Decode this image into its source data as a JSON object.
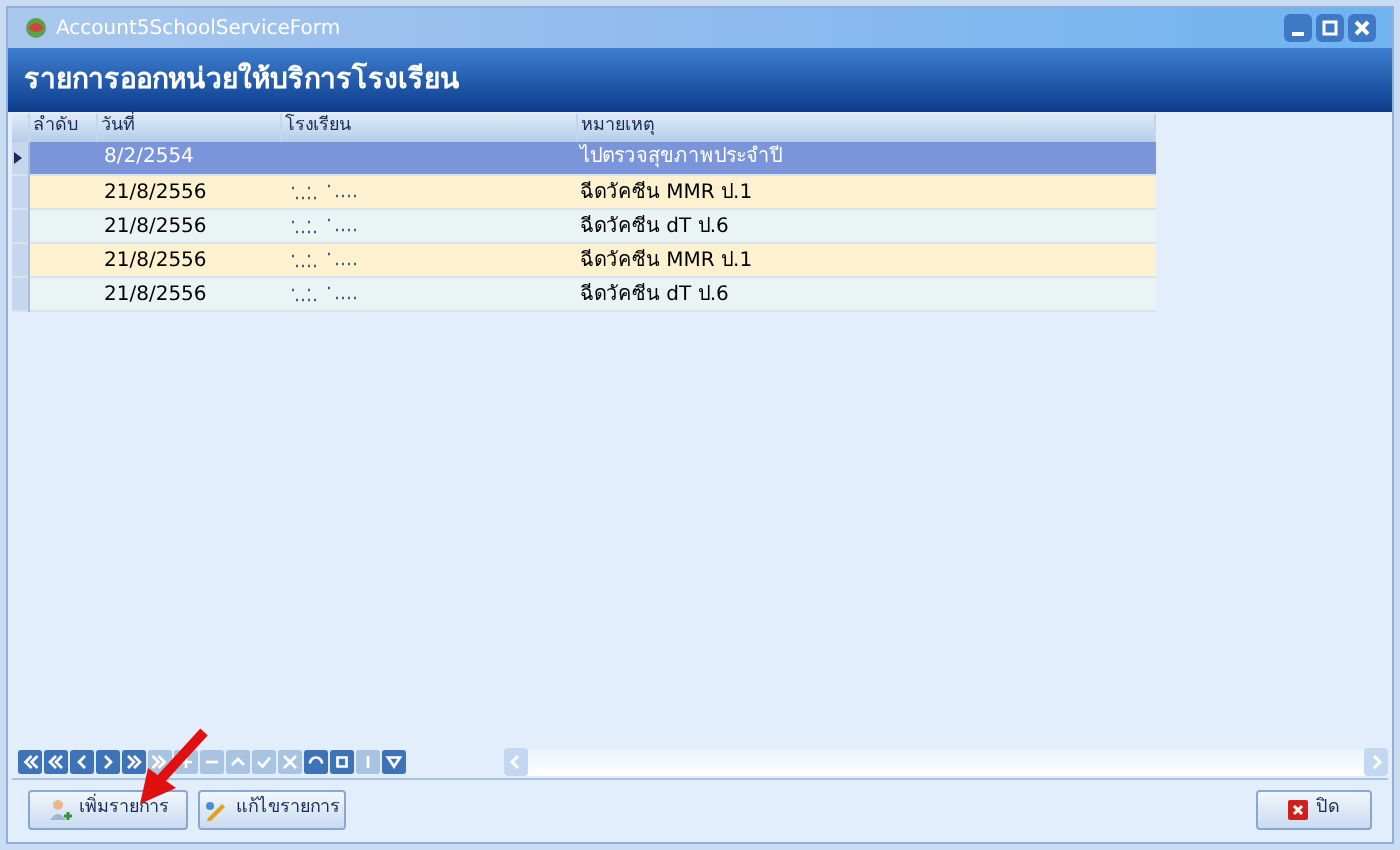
{
  "window": {
    "title": "Account5SchoolServiceForm"
  },
  "header": {
    "title": "รายการออกหน่วยให้บริการโรงเรียน"
  },
  "table": {
    "columns": [
      "ลำดับ",
      "วันที่",
      "โรงเรียน",
      "หมายเหตุ"
    ],
    "rows": [
      {
        "selected": true,
        "date": "8/2/2554",
        "school_redacted": false,
        "note": "ไปตรวจสุขภาพประจำปี"
      },
      {
        "selected": false,
        "date": "21/8/2556",
        "school_redacted": true,
        "note": "ฉีดวัคซีน MMR ป.1"
      },
      {
        "selected": false,
        "date": "21/8/2556",
        "school_redacted": true,
        "note": "ฉีดวัคซีน dT ป.6"
      },
      {
        "selected": false,
        "date": "21/8/2556",
        "school_redacted": true,
        "note": "ฉีดวัคซีน MMR ป.1"
      },
      {
        "selected": false,
        "date": "21/8/2556",
        "school_redacted": true,
        "note": "ฉีดวัคซีน dT ป.6"
      }
    ]
  },
  "buttons": [
    {
      "kind": "add",
      "label": "เพิ่มรายการ"
    },
    {
      "kind": "edit",
      "label": "แก้ไขรายการ"
    }
  ],
  "close_button": {
    "label": "ปิด"
  },
  "annotation_arrow": true
}
